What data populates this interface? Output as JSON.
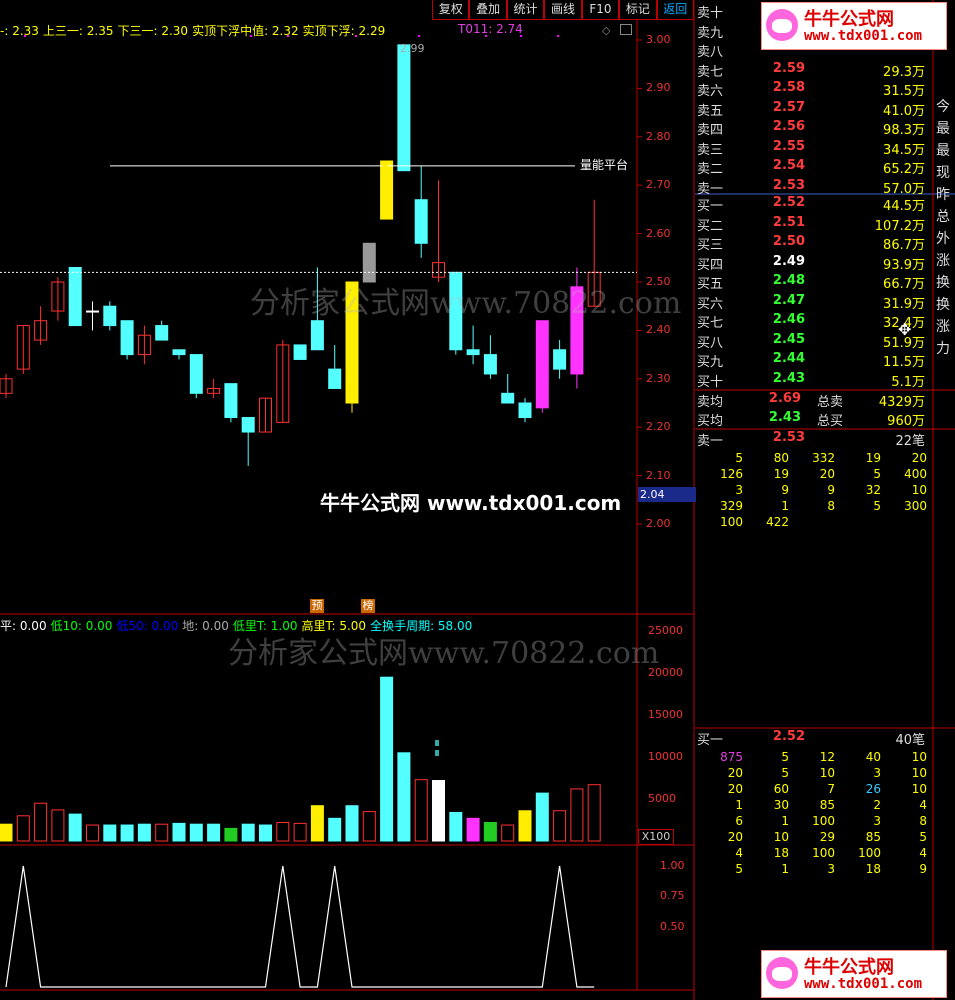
{
  "toolbar": {
    "items": [
      "复权",
      "叠加",
      "统计",
      "画线",
      "F10",
      "标记",
      "返回"
    ]
  },
  "indicator_line": {
    "items": [
      {
        "text": "-: 2.33",
        "color": "#ffff00"
      },
      {
        "text": "上三一: 2.35",
        "color": "#ffff00"
      },
      {
        "text": "下三一: 2.30",
        "color": "#ffff00"
      },
      {
        "text": "实顶下浮中值: 2.32",
        "color": "#ffff00"
      },
      {
        "text": "实顶下浮: 2.29",
        "color": "#ffff00"
      }
    ],
    "t011": "T011: 2.74"
  },
  "price_axis": [
    "3.00",
    "2.90",
    "2.80",
    "2.70",
    "2.60",
    "2.50",
    "2.40",
    "2.30",
    "2.20",
    "2.10",
    "2.00"
  ],
  "current_price_tag": "2.04",
  "peak_label": "2.99",
  "platform_label": "量能平台",
  "markers": {
    "yu": "预",
    "bang": "榜"
  },
  "volume_line": {
    "items": [
      {
        "text": "平: 0.00",
        "color": "#ffffff"
      },
      {
        "text": "低10: 0.00",
        "color": "#00ff00"
      },
      {
        "text": "低50: 0.00",
        "color": "#0000ff"
      },
      {
        "text": "地: 0.00",
        "color": "#aaaaaa"
      },
      {
        "text": "低里T: 1.00",
        "color": "#00ff00"
      },
      {
        "text": "高里T: 5.00",
        "color": "#ffff00"
      },
      {
        "text": "全换手周期: 58.00",
        "color": "#00ffff"
      }
    ]
  },
  "volume_axis": [
    "25000",
    "20000",
    "15000",
    "10000",
    "5000"
  ],
  "volume_unit": "X100",
  "signal_axis": [
    "1.00",
    "0.75",
    "0.50"
  ],
  "watermark": "分析家公式网www.70822.com",
  "brand": {
    "center": "牛牛公式网 www.tdx001.com",
    "logo_name": "牛牛公式网",
    "logo_url": "www.tdx001.com"
  },
  "order_book": {
    "sell": [
      {
        "name": "卖十",
        "price": "",
        "vol": ""
      },
      {
        "name": "卖九",
        "price": "",
        "vol": ""
      },
      {
        "name": "卖八",
        "price": "",
        "vol": ""
      },
      {
        "name": "卖七",
        "price": "2.59",
        "vol": "29.3万"
      },
      {
        "name": "卖六",
        "price": "2.58",
        "vol": "31.5万"
      },
      {
        "name": "卖五",
        "price": "2.57",
        "vol": "41.0万"
      },
      {
        "name": "卖四",
        "price": "2.56",
        "vol": "98.3万"
      },
      {
        "name": "卖三",
        "price": "2.55",
        "vol": "34.5万"
      },
      {
        "name": "卖二",
        "price": "2.54",
        "vol": "65.2万"
      },
      {
        "name": "卖一",
        "price": "2.53",
        "vol": "57.0万"
      }
    ],
    "buy": [
      {
        "name": "买一",
        "price": "2.52",
        "vol": "44.5万",
        "color": "#ff3b3b"
      },
      {
        "name": "买二",
        "price": "2.51",
        "vol": "107.2万",
        "color": "#ff3b3b"
      },
      {
        "name": "买三",
        "price": "2.50",
        "vol": "86.7万",
        "color": "#ff3b3b"
      },
      {
        "name": "买四",
        "price": "2.49",
        "vol": "93.9万",
        "color": "#ffffff"
      },
      {
        "name": "买五",
        "price": "2.48",
        "vol": "66.7万",
        "color": "#33ff33"
      },
      {
        "name": "买六",
        "price": "2.47",
        "vol": "31.9万",
        "color": "#33ff33"
      },
      {
        "name": "买七",
        "price": "2.46",
        "vol": "32.4万",
        "color": "#33ff33"
      },
      {
        "name": "买八",
        "price": "2.45",
        "vol": "51.9万",
        "color": "#33ff33"
      },
      {
        "name": "买九",
        "price": "2.44",
        "vol": "11.5万",
        "color": "#33ff33"
      },
      {
        "name": "买十",
        "price": "2.43",
        "vol": "5.1万",
        "color": "#33ff33"
      }
    ],
    "avg_sell": {
      "name": "卖均",
      "price": "2.69",
      "label": "总卖",
      "vol": "4329万"
    },
    "avg_buy": {
      "name": "买均",
      "price": "2.43",
      "label": "总买",
      "vol": "960万"
    },
    "sell1_queue": {
      "name": "卖一",
      "price": "2.53",
      "count": "22笔",
      "rows": [
        [
          "5",
          "80",
          "332",
          "19",
          "20"
        ],
        [
          "126",
          "19",
          "20",
          "5",
          "400"
        ],
        [
          "3",
          "9",
          "9",
          "32",
          "10"
        ],
        [
          "329",
          "1",
          "8",
          "5",
          "300"
        ],
        [
          "100",
          "422",
          "",
          "",
          ""
        ]
      ]
    },
    "buy1_queue": {
      "name": "买一",
      "price": "2.52",
      "count": "40笔",
      "rows": [
        [
          "875",
          "5",
          "12",
          "40",
          "10"
        ],
        [
          "20",
          "5",
          "10",
          "3",
          "10"
        ],
        [
          "20",
          "60",
          "7",
          "26",
          "10"
        ],
        [
          "1",
          "30",
          "85",
          "2",
          "4"
        ],
        [
          "6",
          "1",
          "100",
          "3",
          "8"
        ],
        [
          "20",
          "10",
          "29",
          "85",
          "5"
        ],
        [
          "4",
          "18",
          "100",
          "100",
          "4"
        ],
        [
          "5",
          "1",
          "3",
          "18",
          "9"
        ]
      ]
    }
  },
  "side_strip": [
    "今",
    "最",
    "最",
    "现",
    "昨",
    "总",
    "外",
    "涨",
    "换",
    "换",
    "涨",
    "力"
  ],
  "chart_data": [
    {
      "type": "candlestick",
      "ylim": [
        2.0,
        3.0
      ],
      "candles": [
        {
          "o": 2.27,
          "h": 2.31,
          "l": 2.26,
          "c": 2.3,
          "color": "up"
        },
        {
          "o": 2.32,
          "h": 2.41,
          "l": 2.31,
          "c": 2.41,
          "color": "up"
        },
        {
          "o": 2.38,
          "h": 2.45,
          "l": 2.37,
          "c": 2.42,
          "color": "up"
        },
        {
          "o": 2.44,
          "h": 2.51,
          "l": 2.42,
          "c": 2.5,
          "color": "up"
        },
        {
          "o": 2.53,
          "h": 2.53,
          "l": 2.41,
          "c": 2.41,
          "color": "down"
        },
        {
          "o": 2.44,
          "h": 2.46,
          "l": 2.4,
          "c": 2.44,
          "color": "doji"
        },
        {
          "o": 2.45,
          "h": 2.46,
          "l": 2.4,
          "c": 2.41,
          "color": "down"
        },
        {
          "o": 2.42,
          "h": 2.42,
          "l": 2.34,
          "c": 2.35,
          "color": "down"
        },
        {
          "o": 2.35,
          "h": 2.41,
          "l": 2.33,
          "c": 2.39,
          "color": "up"
        },
        {
          "o": 2.41,
          "h": 2.42,
          "l": 2.38,
          "c": 2.38,
          "color": "down"
        },
        {
          "o": 2.36,
          "h": 2.36,
          "l": 2.34,
          "c": 2.35,
          "color": "down"
        },
        {
          "o": 2.35,
          "h": 2.35,
          "l": 2.26,
          "c": 2.27,
          "color": "down"
        },
        {
          "o": 2.27,
          "h": 2.3,
          "l": 2.26,
          "c": 2.28,
          "color": "up"
        },
        {
          "o": 2.29,
          "h": 2.29,
          "l": 2.21,
          "c": 2.22,
          "color": "down"
        },
        {
          "o": 2.22,
          "h": 2.22,
          "l": 2.12,
          "c": 2.19,
          "color": "down"
        },
        {
          "o": 2.19,
          "h": 2.26,
          "l": 2.19,
          "c": 2.26,
          "color": "up"
        },
        {
          "o": 2.21,
          "h": 2.38,
          "l": 2.21,
          "c": 2.37,
          "color": "up"
        },
        {
          "o": 2.37,
          "h": 2.37,
          "l": 2.34,
          "c": 2.34,
          "color": "down"
        },
        {
          "o": 2.36,
          "h": 2.53,
          "l": 2.36,
          "c": 2.42,
          "color": "down"
        },
        {
          "o": 2.32,
          "h": 2.37,
          "l": 2.28,
          "c": 2.28,
          "color": "down"
        },
        {
          "o": 2.25,
          "h": 2.5,
          "l": 2.23,
          "c": 2.5,
          "color": "yellow"
        },
        {
          "o": 2.58,
          "h": 2.58,
          "l": 2.5,
          "c": 2.5,
          "color": "gray"
        },
        {
          "o": 2.63,
          "h": 2.75,
          "l": 2.63,
          "c": 2.75,
          "color": "yellow"
        },
        {
          "o": 2.73,
          "h": 2.99,
          "l": 2.73,
          "c": 2.99,
          "color": "down"
        },
        {
          "o": 2.67,
          "h": 2.74,
          "l": 2.55,
          "c": 2.58,
          "color": "down"
        },
        {
          "o": 2.51,
          "h": 2.71,
          "l": 2.5,
          "c": 2.54,
          "color": "up"
        },
        {
          "o": 2.52,
          "h": 2.52,
          "l": 2.35,
          "c": 2.36,
          "color": "down"
        },
        {
          "o": 2.35,
          "h": 2.41,
          "l": 2.33,
          "c": 2.36,
          "color": "down"
        },
        {
          "o": 2.35,
          "h": 2.39,
          "l": 2.3,
          "c": 2.31,
          "color": "down"
        },
        {
          "o": 2.27,
          "h": 2.31,
          "l": 2.25,
          "c": 2.25,
          "color": "down"
        },
        {
          "o": 2.25,
          "h": 2.26,
          "l": 2.21,
          "c": 2.22,
          "color": "down"
        },
        {
          "o": 2.24,
          "h": 2.42,
          "l": 2.23,
          "c": 2.42,
          "color": "magenta"
        },
        {
          "o": 2.32,
          "h": 2.38,
          "l": 2.3,
          "c": 2.36,
          "color": "down"
        },
        {
          "o": 2.31,
          "h": 2.53,
          "l": 2.28,
          "c": 2.49,
          "color": "magenta"
        },
        {
          "o": 2.45,
          "h": 2.67,
          "l": 2.45,
          "c": 2.52,
          "color": "up"
        }
      ],
      "hlines": [
        {
          "label": "量能平台",
          "value": 2.74
        },
        {
          "value": 2.52,
          "dashed": true
        }
      ]
    },
    {
      "type": "bar",
      "title": "volume",
      "ylim": [
        0,
        25000
      ],
      "values": [
        2000,
        3000,
        4500,
        3700,
        3200,
        1900,
        1900,
        1900,
        2000,
        2000,
        2100,
        2000,
        2000,
        1500,
        2000,
        1900,
        2200,
        2100,
        4200,
        2700,
        4200,
        3500,
        19500,
        10500,
        7300,
        7200,
        3400,
        2700,
        2200,
        1900,
        3600,
        5700,
        3600,
        6200,
        6700
      ],
      "colors": [
        "yellow",
        "up",
        "up",
        "up",
        "down",
        "up",
        "down",
        "down",
        "down",
        "up",
        "down",
        "down",
        "down",
        "green",
        "down",
        "down",
        "up",
        "up",
        "yellow",
        "down",
        "down",
        "up",
        "down",
        "down",
        "up",
        "white",
        "down",
        "magenta",
        "green",
        "up",
        "yellow",
        "down",
        "up",
        "up",
        "up"
      ]
    },
    {
      "type": "line",
      "title": "signal",
      "ylim": [
        0,
        1.2
      ],
      "values": [
        0,
        1,
        0,
        0,
        0,
        0,
        0,
        0,
        0,
        0,
        0,
        0,
        0,
        0,
        0,
        0,
        1,
        0,
        0,
        1,
        0,
        0,
        0,
        0,
        0,
        0,
        0,
        0,
        0,
        0,
        0,
        0,
        1,
        0,
        0
      ]
    }
  ]
}
